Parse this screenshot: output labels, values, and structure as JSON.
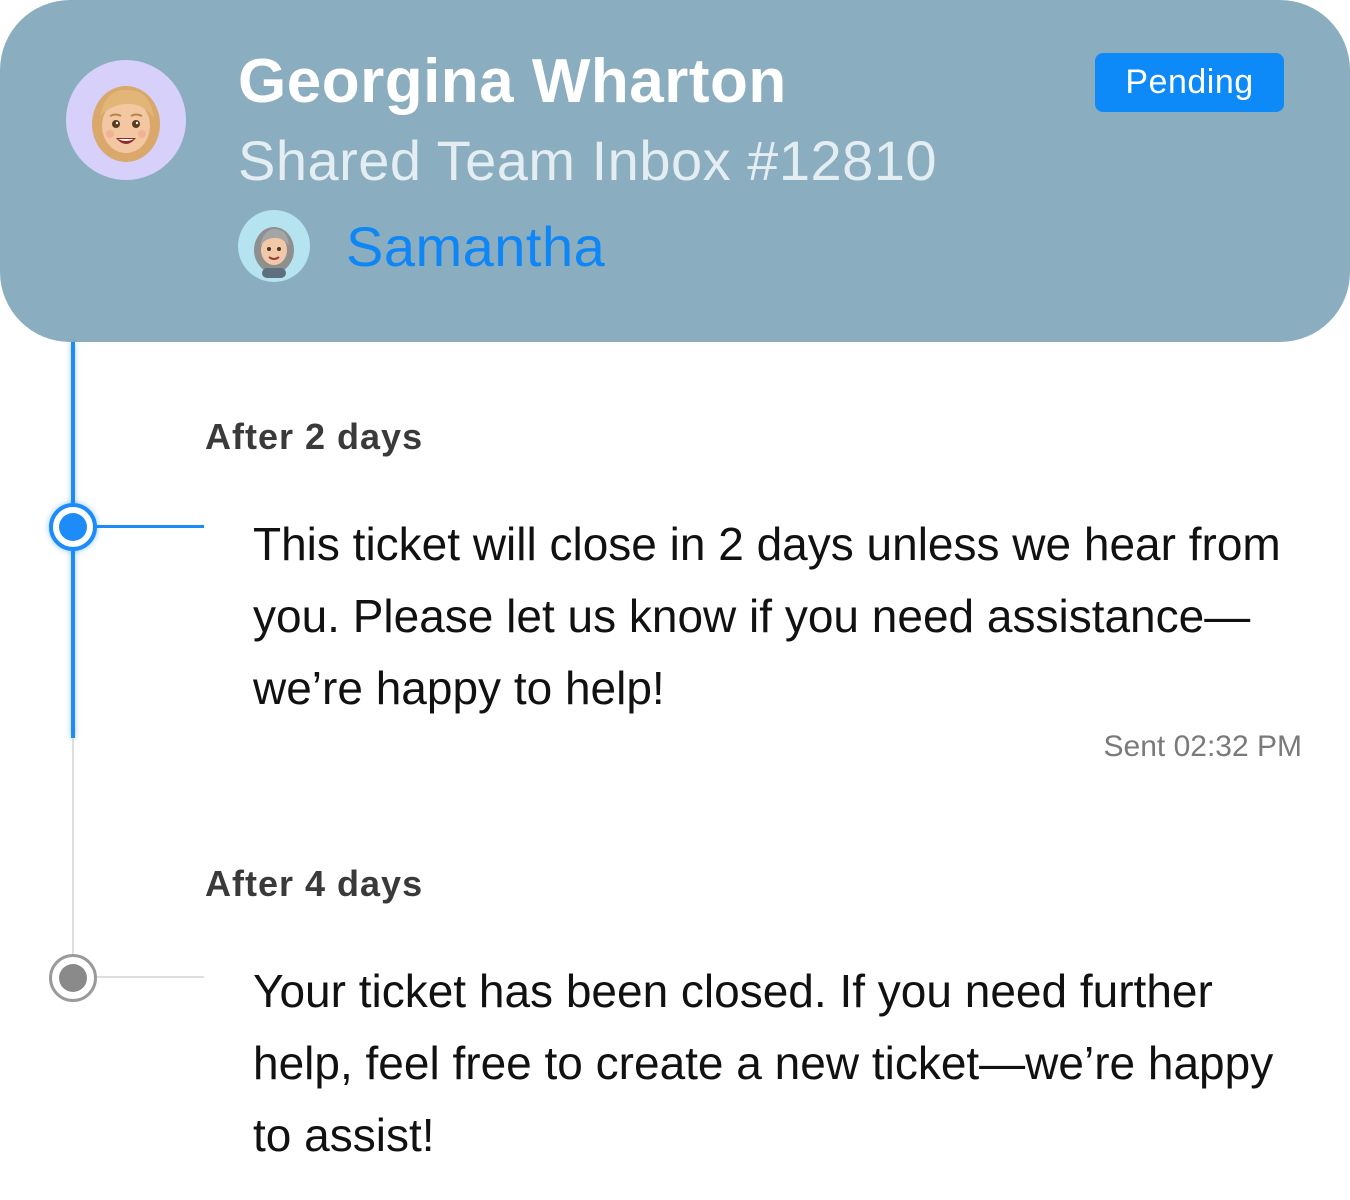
{
  "header": {
    "customer_name": "Georgina Wharton",
    "inbox": "Shared Team Inbox #12810",
    "agent_name": "Samantha",
    "status": "Pending",
    "avatar_icon": "memoji-woman-blonde",
    "agent_avatar_icon": "memoji-woman-gray-hair"
  },
  "timeline": [
    {
      "label": "After 2 days",
      "message": "This ticket will close in 2 days unless we hear from you. Please let us know if you need assistance—we’re happy to help!",
      "sent": "Sent 02:32 PM",
      "state": "active"
    },
    {
      "label": "After 4 days",
      "message": "Your ticket has been closed. If you need further help, feel free to create a new ticket—we’re happy to assist!",
      "state": "inactive"
    }
  ],
  "colors": {
    "header_bg": "#8aaebf",
    "accent": "#0d8af8",
    "inactive_node": "#8a8a8a"
  }
}
